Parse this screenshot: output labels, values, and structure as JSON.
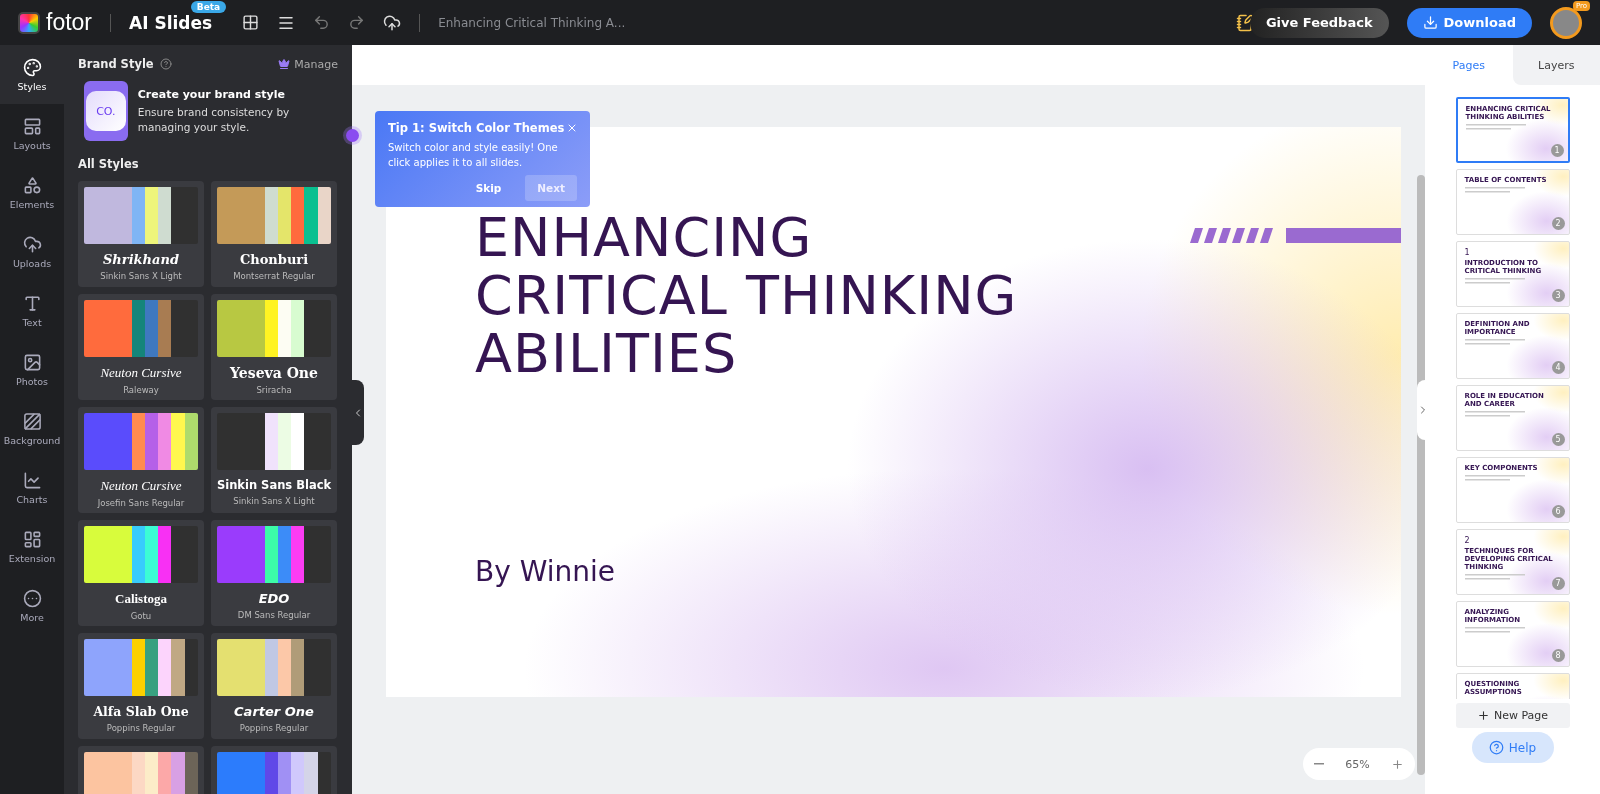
{
  "topbar": {
    "logo": "fotor",
    "product": "AI Slides",
    "badge": "Beta",
    "doc_title": "Enhancing Critical Thinking A...",
    "feedback": "Give Feedback",
    "download": "Download",
    "avatar_badge": "Pro"
  },
  "rail": [
    {
      "label": "Styles",
      "selected": true
    },
    {
      "label": "Layouts",
      "selected": false
    },
    {
      "label": "Elements",
      "selected": false
    },
    {
      "label": "Uploads",
      "selected": false
    },
    {
      "label": "Text",
      "selected": false
    },
    {
      "label": "Photos",
      "selected": false
    },
    {
      "label": "Background",
      "selected": false
    },
    {
      "label": "Charts",
      "selected": false
    },
    {
      "label": "Extension",
      "selected": false
    },
    {
      "label": "More",
      "selected": false
    }
  ],
  "panel": {
    "heading": "Brand Style",
    "manage": "Manage",
    "brand_logo": "CO.",
    "brand_title": "Create your brand style",
    "brand_text": "Ensure brand consistency by managing your style.",
    "styles_heading": "All Styles",
    "styles": [
      {
        "title": "Shrikhand",
        "subtitle": "Sinkin Sans X Light",
        "swatches": [
          {
            "color": "#c0b8de"
          },
          {
            "color": "#7fb5f5"
          },
          {
            "color": "#eef57a"
          },
          {
            "color": "#cfdcd0"
          }
        ]
      },
      {
        "title": "Chonburi",
        "subtitle": "Montserrat Regular",
        "swatches": [
          {
            "color": "#c49a58"
          },
          {
            "color": "#cfdcd0"
          },
          {
            "color": "#e4e56a"
          },
          {
            "color": "#ff6a3d"
          },
          {
            "color": "#09c090"
          },
          {
            "color": "#e9d5c8"
          }
        ]
      },
      {
        "title": "Neuton Cursive",
        "subtitle": "Raleway",
        "swatches": [
          {
            "color": "#ff6b3d"
          },
          {
            "color": "#15857a"
          },
          {
            "color": "#3f78bf"
          },
          {
            "color": "#a87c52"
          }
        ]
      },
      {
        "title": "Yeseva One",
        "subtitle": "Sriracha",
        "swatches": [
          {
            "color": "#b8c842"
          },
          {
            "color": "#fff323"
          },
          {
            "color": "#fdfdf3"
          },
          {
            "color": "#d8fcd0"
          }
        ]
      },
      {
        "title": "Neuton Cursive",
        "subtitle": "Josefin Sans Regular",
        "swatches": [
          {
            "color": "#5a4cfc"
          },
          {
            "color": "#ff8b50"
          },
          {
            "color": "#b560e8"
          },
          {
            "color": "#f08ae4"
          },
          {
            "color": "#fff74e"
          },
          {
            "color": "#aedb6c"
          }
        ]
      },
      {
        "title": "Sinkin Sans Black",
        "subtitle": "Sinkin Sans X Light",
        "swatches": [
          {
            "color": "#303030"
          },
          {
            "color": "#f0e2fc"
          },
          {
            "color": "#ecfce4"
          },
          {
            "color": "#ffffff"
          }
        ]
      },
      {
        "title": "Calistoga",
        "subtitle": "Gotu",
        "swatches": [
          {
            "color": "#d8fc3c"
          },
          {
            "color": "#38ccfc"
          },
          {
            "color": "#3cfcd4"
          },
          {
            "color": "#f830f4"
          }
        ]
      },
      {
        "title": "EDO",
        "subtitle": "DM Sans Regular",
        "swatches": [
          {
            "color": "#9a3cfc"
          },
          {
            "color": "#3cfca8"
          },
          {
            "color": "#3c8cf8"
          },
          {
            "color": "#fc3cf4"
          }
        ]
      },
      {
        "title": "Alfa Slab One",
        "subtitle": "Poppins Regular",
        "swatches": [
          {
            "color": "#8ea4fc"
          },
          {
            "color": "#fcd000"
          },
          {
            "color": "#38a080"
          },
          {
            "color": "#fcd4fc"
          },
          {
            "color": "#c0a884"
          }
        ]
      },
      {
        "title": "Carter One",
        "subtitle": "Poppins Regular",
        "swatches": [
          {
            "color": "#e4e070"
          },
          {
            "color": "#c0c8e4"
          },
          {
            "color": "#fcc8a8"
          },
          {
            "color": "#b09c78"
          }
        ]
      },
      {
        "swatches": [
          {
            "color": "#fcc4a0"
          },
          {
            "color": "#fcd8c4"
          },
          {
            "color": "#fcecc8"
          },
          {
            "color": "#fca8a8"
          },
          {
            "color": "#d8a0e4"
          },
          {
            "color": "#6c6458"
          }
        ]
      },
      {
        "swatches": [
          {
            "color": "#2c7cfc"
          },
          {
            "color": "#6048e8"
          },
          {
            "color": "#a090f4"
          },
          {
            "color": "#d0c8fc"
          },
          {
            "color": "#d4d4e8"
          }
        ]
      }
    ]
  },
  "tooltip": {
    "title": "Tip 1: Switch Color Themes",
    "text": "Switch color and style easily! One click applies it to all slides.",
    "skip": "Skip",
    "next": "Next"
  },
  "slide": {
    "title_lines": [
      "ENHANCING",
      "CRITICAL THINKING",
      "ABILITIES"
    ],
    "author": "By Winnie"
  },
  "zoom": {
    "value": "65%"
  },
  "pages_panel": {
    "tabs": [
      {
        "label": "Pages",
        "selected": true
      },
      {
        "label": "Layers",
        "selected": false
      }
    ],
    "pages": [
      {
        "number": "1",
        "title": "ENHANCING CRITICAL THINKING ABILITIES",
        "selected": true
      },
      {
        "number": "2",
        "title": "TABLE OF CONTENTS",
        "selected": false
      },
      {
        "number": "3",
        "section": "1",
        "title": "INTRODUCTION TO CRITICAL THINKING",
        "selected": false
      },
      {
        "number": "4",
        "title": "DEFINITION AND IMPORTANCE",
        "selected": false
      },
      {
        "number": "5",
        "title": "ROLE IN EDUCATION AND CAREER",
        "selected": false
      },
      {
        "number": "6",
        "title": "KEY COMPONENTS",
        "selected": false
      },
      {
        "number": "7",
        "section": "2",
        "title": "TECHNIQUES FOR DEVELOPING CRITICAL THINKING",
        "selected": false
      },
      {
        "number": "8",
        "title": "ANALYZING INFORMATION",
        "selected": false
      },
      {
        "title": "QUESTIONING ASSUMPTIONS",
        "selected": false
      }
    ],
    "new_page": "New Page",
    "help": "Help"
  }
}
